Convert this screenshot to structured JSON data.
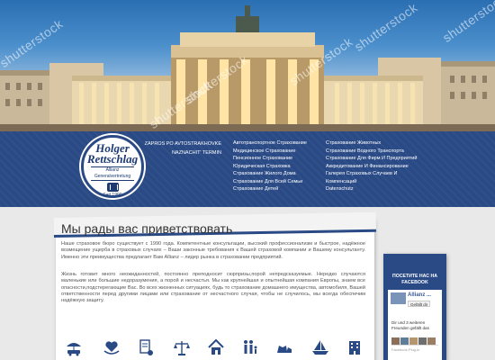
{
  "watermark": "shutterstock",
  "quick_links": [
    "ZAPROS PO AVTOSTRAKHOVKE",
    "NAZNACHIT' TERMIN"
  ],
  "nav_col1": [
    "Автотранспортное Страхование",
    "Медицинское Страхование",
    "Пенсионное Страхование",
    "Юридическая Страховка",
    "Страхование Жилого Дома",
    "Страхование Для Всей Семьи",
    "Страхование Детей"
  ],
  "nav_col2": [
    "Страхование Животных",
    "Страхование Водного Транспорта",
    "Страхование Для Фирм И Предприятий",
    "Аккредитование И Финансирование",
    "Галерея Страховых Случаев И Компенсаций",
    "Datenschutz"
  ],
  "logo": {
    "line1": "Holger",
    "line2": "Rettschlag",
    "line3": "Allianz Generalvertretung",
    "line4": "Seit 1990"
  },
  "main": {
    "title": "Мы рады вас приветствовать",
    "paragraph1": "Наше страховое бюро существует с 1990 года. Компетентные консультации, высокий профессионализм и быстрое, надёжное возмещение ущерба в страховых случаях – Ваши законные требования к Вашей страховой компании и Вашему консультанту. Именно эти преимущества предлагает Вам Allianz – лидер рынка в страховании предприятий.",
    "paragraph2": "Жизнь готовит много неожиданностей, постоянно преподносит сюрпризы,порой непредсказуемые. Нередко случаются маленькие или большие недоразумения, а порой и несчастья. Мы как крупнейшая и опытнейшая компания Европы, знаем все опасности,подстерегающие Вас. Во всех жизненных ситуациях, будь то страхование домашнего имущества, автомобиля, Вашей ответственности перед другими лицами или страхование от несчастного случая, чтобы не случилось, мы всегда обеспечим надёжную защиту."
  },
  "icons": [
    "car-umbrella-icon",
    "heart-hands-icon",
    "document-coins-icon",
    "scales-justice-icon",
    "house-icon",
    "family-icon",
    "pets-icon",
    "boat-icon",
    "building-icon"
  ],
  "facebook": {
    "title": "ПОСЕТИТЕ НАС НА FACEBOOK",
    "page_name": "Allianz ...",
    "like_label": "Gefällt dir",
    "friends_text": "Dir und 3 weiteren Freunden gefällt das",
    "plugin_label": "Facebook-Plug-in"
  },
  "colors": {
    "navy": "#2a4a86",
    "accent": "#1d3a73"
  }
}
